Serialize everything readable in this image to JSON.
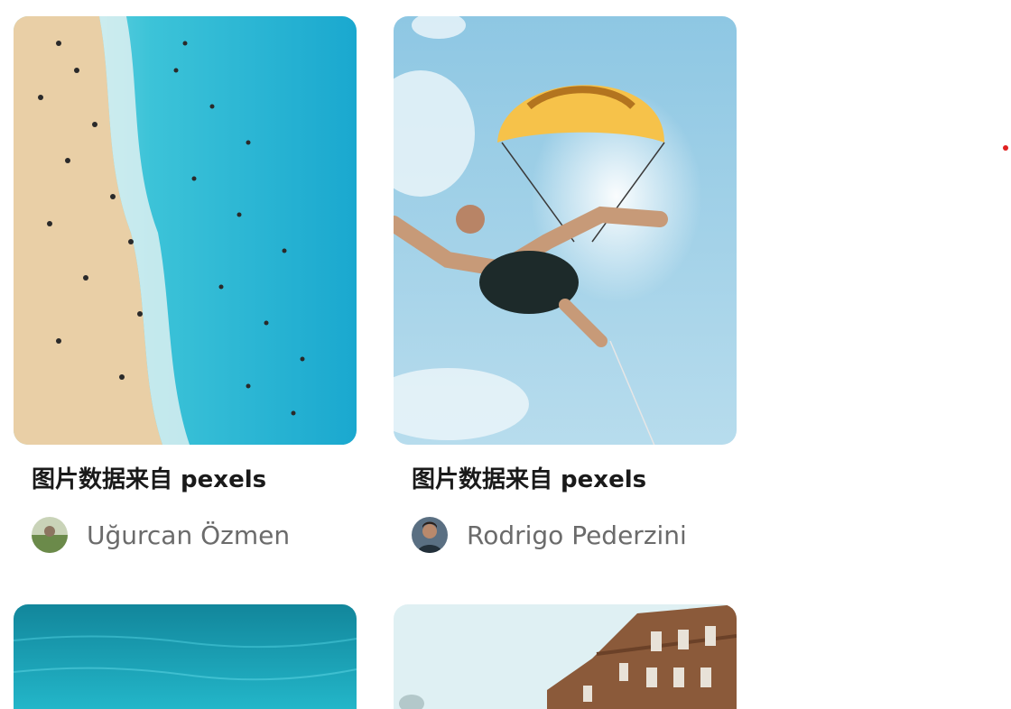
{
  "feed": {
    "cards": [
      {
        "title": "图片数据来自 pexels",
        "author": "Uğurcan Özmen",
        "photo_subject": "beach-aerial"
      },
      {
        "title": "图片数据来自 pexels",
        "author": "Rodrigo Pederzini",
        "photo_subject": "parasailing"
      },
      {
        "photo_subject": "ocean-surface"
      },
      {
        "photo_subject": "building-facade"
      }
    ]
  },
  "colors": {
    "title_text": "#1a1a1a",
    "author_text": "#6b6b6b",
    "indicator": "#e02020"
  }
}
